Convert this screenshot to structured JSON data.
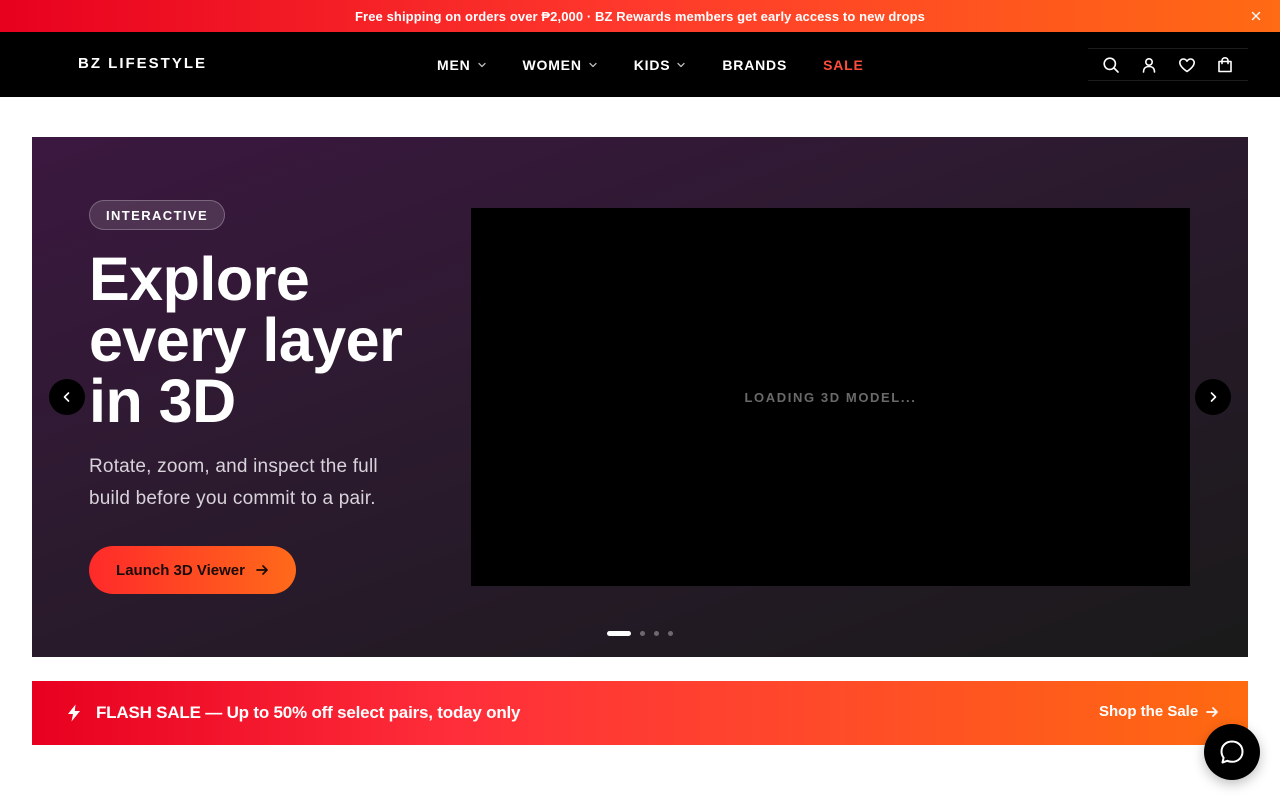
{
  "announcement": {
    "text": "Free shipping on orders over ₱2,000 · BZ Rewards members get early access to new drops",
    "close_icon": "close-icon"
  },
  "header": {
    "logo": "BZ LIFESTYLE",
    "nav": [
      {
        "label": "MEN",
        "has_dropdown": true
      },
      {
        "label": "WOMEN",
        "has_dropdown": true
      },
      {
        "label": "KIDS",
        "has_dropdown": true
      },
      {
        "label": "BRANDS",
        "has_dropdown": false
      },
      {
        "label": "SALE",
        "has_dropdown": false
      }
    ],
    "icons": [
      "search-icon",
      "account-icon",
      "wishlist-icon",
      "cart-icon"
    ]
  },
  "hero": {
    "badge": "INTERACTIVE",
    "title": "Explore every layer in 3D",
    "subtitle": "Rotate, zoom, and inspect the full build before you commit to a pair.",
    "cta": "Launch 3D Viewer",
    "viewer_status": "LOADING 3D MODEL...",
    "slides_total": 4,
    "active_slide": 1
  },
  "flash_sale": {
    "text": "FLASH SALE — Up to 50% off select pairs, today only",
    "link": "Shop the Sale"
  },
  "colors": {
    "accent_red": "#e8001f",
    "accent_orange": "#ff6a14",
    "sale_red": "#ff4d3d",
    "header_bg": "#000000"
  }
}
